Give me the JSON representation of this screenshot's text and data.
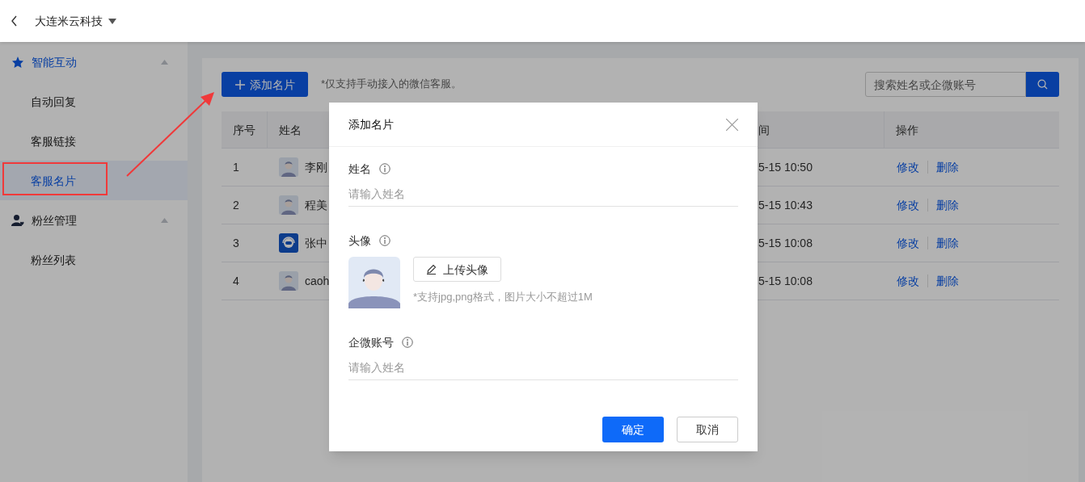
{
  "header": {
    "company": "大连米云科技"
  },
  "sidebar": {
    "groups": [
      {
        "label": "智能互动",
        "kind": "interaction",
        "active": true,
        "expanded": true,
        "children": [
          {
            "label": "自动回复",
            "selected": false
          },
          {
            "label": "客服链接",
            "selected": false
          },
          {
            "label": "客服名片",
            "selected": true
          }
        ]
      },
      {
        "label": "粉丝管理",
        "kind": "fans",
        "active": false,
        "expanded": true,
        "children": [
          {
            "label": "粉丝列表",
            "selected": false
          }
        ]
      }
    ]
  },
  "toolbar": {
    "add_button": "添加名片",
    "note": "*仅支持手动接入的微信客服。",
    "search": {
      "placeholder": "搜索姓名或企微账号"
    }
  },
  "table": {
    "columns": [
      "序号",
      "姓名",
      "间",
      "操作"
    ],
    "rows": [
      {
        "index": "1",
        "kind": "person",
        "name": "李刚",
        "time": "5-15 10:50",
        "actions": [
          "修改",
          "删除"
        ]
      },
      {
        "index": "2",
        "kind": "person",
        "name": "程美",
        "time": "5-15 10:43",
        "actions": [
          "修改",
          "删除"
        ]
      },
      {
        "index": "3",
        "kind": "robot",
        "name": "张中",
        "time": "5-15 10:08",
        "actions": [
          "修改",
          "删除"
        ]
      },
      {
        "index": "4",
        "kind": "person",
        "name": "caoh",
        "time": "5-15 10:08",
        "actions": [
          "修改",
          "删除"
        ]
      }
    ]
  },
  "modal": {
    "title": "添加名片",
    "fields": [
      {
        "kind": "text",
        "label": "姓名",
        "placeholder": "请输入姓名"
      },
      {
        "kind": "avatar",
        "label": "头像",
        "button": "上传头像",
        "hint": "*支持jpg,png格式，图片大小不超过1M"
      },
      {
        "kind": "text",
        "label": "企微账号",
        "placeholder": "请输入姓名"
      }
    ],
    "buttons": [
      {
        "label": "确定",
        "primary": true
      },
      {
        "label": "取消",
        "primary": false
      }
    ]
  }
}
